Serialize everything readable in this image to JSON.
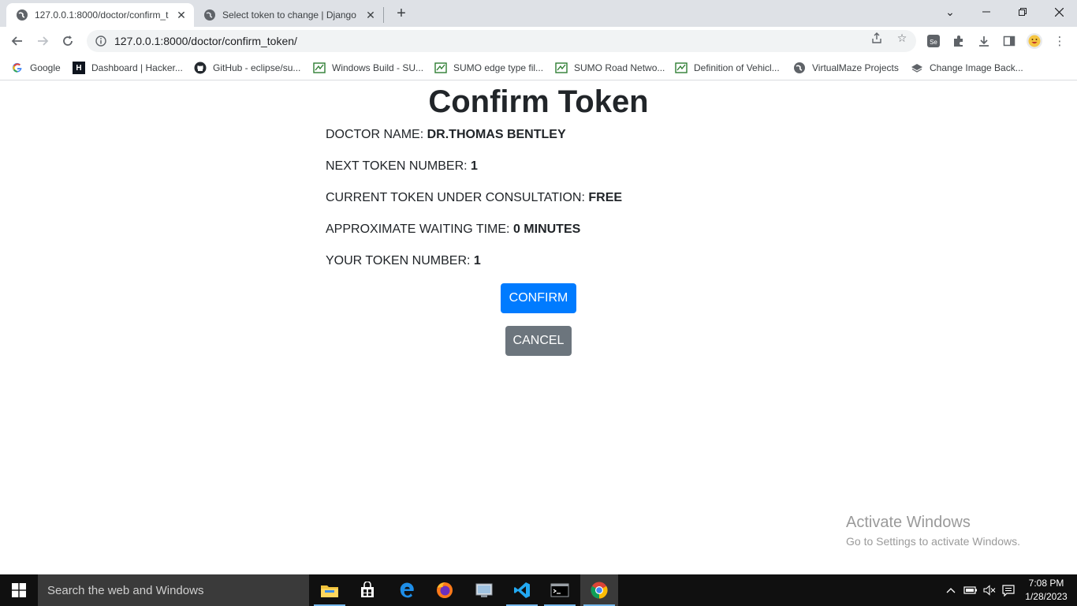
{
  "browser": {
    "tabs": [
      {
        "title": "127.0.0.1:8000/doctor/confirm_to",
        "active": true
      },
      {
        "title": "Select token to change | Django s",
        "active": false
      }
    ],
    "url": "127.0.0.1:8000/doctor/confirm_token/",
    "profile_icon": "emoji-avatar-icon",
    "bookmarks": [
      {
        "label": "Google",
        "icon": "google-icon"
      },
      {
        "label": "Dashboard | Hacker...",
        "icon": "hackerrank-icon"
      },
      {
        "label": "GitHub - eclipse/su...",
        "icon": "github-icon"
      },
      {
        "label": "Windows Build - SU...",
        "icon": "sumo-icon"
      },
      {
        "label": "SUMO edge type fil...",
        "icon": "sumo-icon"
      },
      {
        "label": "SUMO Road Netwo...",
        "icon": "sumo-icon"
      },
      {
        "label": "Definition of Vehicl...",
        "icon": "sumo-icon"
      },
      {
        "label": "VirtualMaze Projects",
        "icon": "globe-icon"
      },
      {
        "label": "Change Image Back...",
        "icon": "layers-icon"
      }
    ]
  },
  "page": {
    "title": "Confirm Token",
    "fields": [
      {
        "label": "DOCTOR NAME:",
        "value": "DR.THOMAS BENTLEY"
      },
      {
        "label": "NEXT TOKEN NUMBER:",
        "value": "1"
      },
      {
        "label": "CURRENT TOKEN UNDER CONSULTATION:",
        "value": "FREE"
      },
      {
        "label": "APPROXIMATE WAITING TIME:",
        "value": "0 MINUTES"
      },
      {
        "label": "YOUR TOKEN NUMBER:",
        "value": "1"
      }
    ],
    "confirm_label": "CONFIRM",
    "cancel_label": "CANCEL",
    "colors": {
      "primary": "#007bff",
      "secondary": "#6c757d"
    }
  },
  "watermark": {
    "line1": "Activate Windows",
    "line2": "Go to Settings to activate Windows."
  },
  "taskbar": {
    "search_placeholder": "Search the web and Windows",
    "time": "7:08 PM",
    "date": "1/28/2023"
  }
}
